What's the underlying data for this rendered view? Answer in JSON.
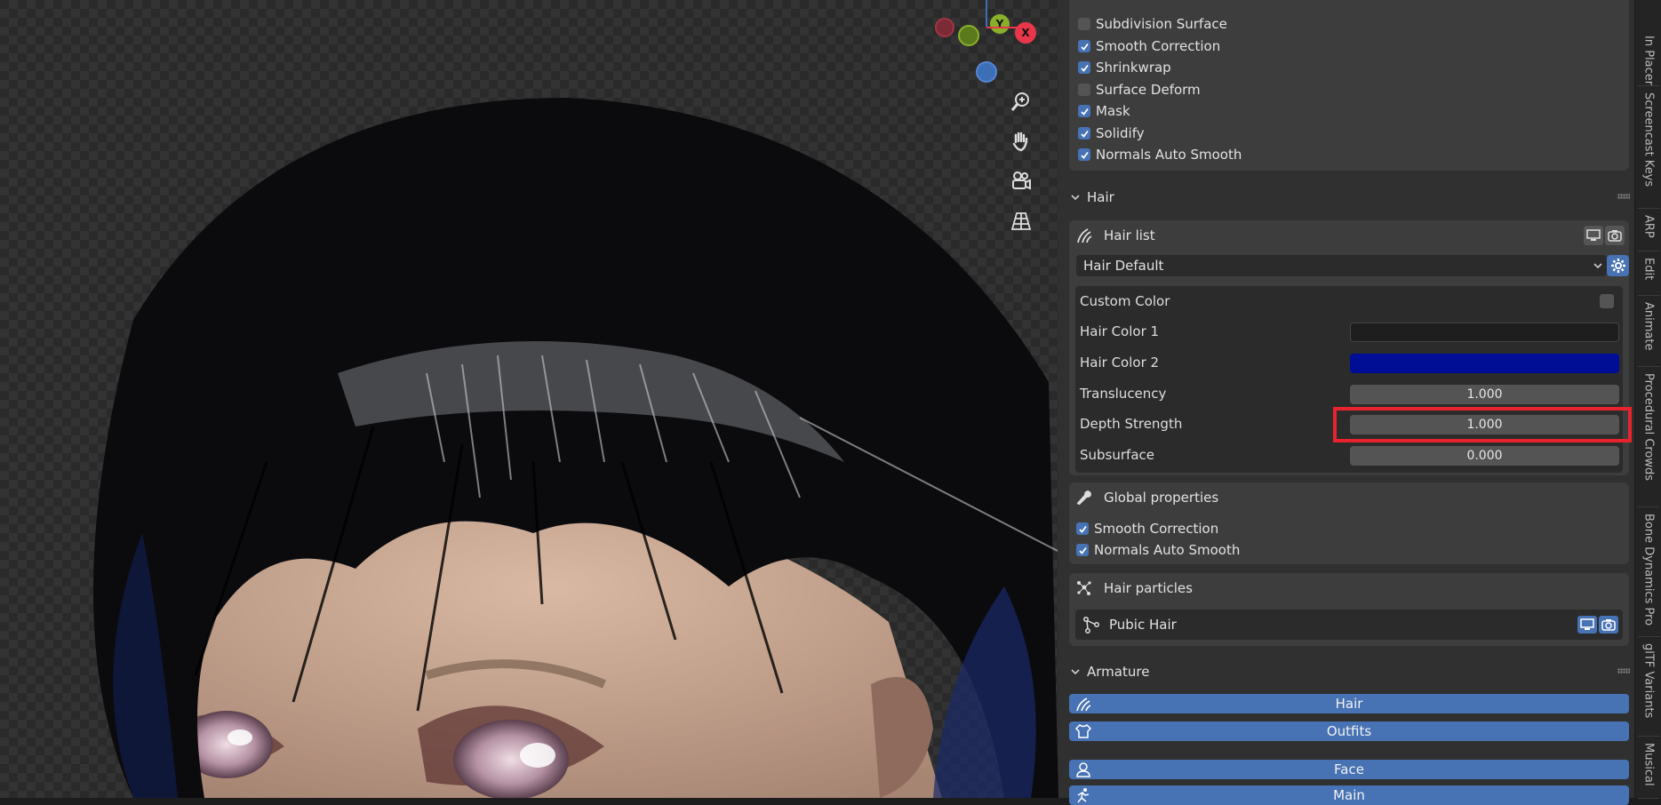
{
  "viewport": {
    "gizmo": {
      "x": "X",
      "y": "Y"
    },
    "nav_tools": [
      "zoom-icon",
      "hand-pan-icon",
      "camera-icon",
      "grid-perspective-icon"
    ]
  },
  "modifiers": {
    "items": [
      {
        "label": "Subdivision Surface",
        "checked": false
      },
      {
        "label": "Smooth Correction",
        "checked": true
      },
      {
        "label": "Shrinkwrap",
        "checked": true
      },
      {
        "label": "Surface Deform",
        "checked": false
      },
      {
        "label": "Mask",
        "checked": true
      },
      {
        "label": "Solidify",
        "checked": true
      },
      {
        "label": "Normals Auto Smooth",
        "checked": true
      }
    ]
  },
  "hair": {
    "section_title": "Hair",
    "list_title": "Hair list",
    "dropdown_value": "Hair Default",
    "custom_color_label": "Custom Color",
    "properties": [
      {
        "label": "Hair Color 1",
        "value": "",
        "color": "#1e1e1e"
      },
      {
        "label": "Hair Color 2",
        "value": "",
        "color": "#000e96"
      },
      {
        "label": "Translucency",
        "value": "1.000"
      },
      {
        "label": "Depth Strength",
        "value": "1.000"
      },
      {
        "label": "Subsurface",
        "value": "0.000"
      }
    ],
    "global_title": "Global properties",
    "global_items": [
      {
        "label": "Smooth Correction",
        "checked": true
      },
      {
        "label": "Normals Auto Smooth",
        "checked": true
      }
    ],
    "particles_title": "Hair particles",
    "particle_item": "Pubic Hair"
  },
  "armature": {
    "section_title": "Armature",
    "buttons": [
      "Hair",
      "Outfits",
      "Face",
      "Main"
    ]
  },
  "side_tabs": [
    "In Placer",
    "Screencast Keys",
    "ARP",
    "Edit",
    "Animate",
    "Procedural Crowds",
    "Bone Dynamics Pro",
    "glTF Variants",
    "Musical"
  ],
  "colors": {
    "accent": "#4772b3",
    "highlight": "#e8232e",
    "hair_color_2": "#000e96"
  }
}
